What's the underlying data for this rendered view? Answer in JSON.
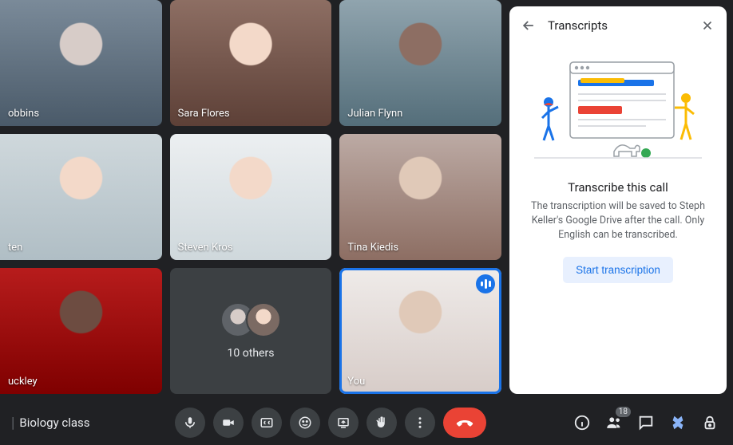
{
  "meeting": {
    "name": "Biology class"
  },
  "tiles": [
    {
      "name": "obbins"
    },
    {
      "name": "Sara Flores"
    },
    {
      "name": "Julian Flynn"
    },
    {
      "name": "ten"
    },
    {
      "name": "Steven Kros"
    },
    {
      "name": "Tina Kiedis"
    },
    {
      "name": "uckley"
    }
  ],
  "others": {
    "label": "10 others"
  },
  "self": {
    "label": "You"
  },
  "panel": {
    "title": "Transcripts",
    "heading": "Transcribe this call",
    "description": "The transcription will be saved to Steph Keller's Google Drive after the call. Only English can be transcribed.",
    "start_label": "Start transcription"
  },
  "participants": {
    "count": "18"
  }
}
